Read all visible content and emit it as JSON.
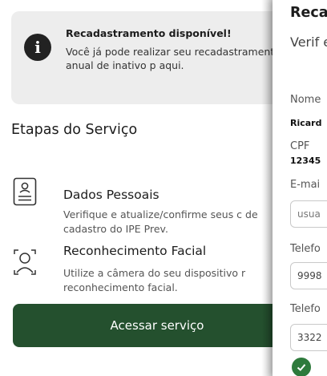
{
  "notice": {
    "title": "Recadastramento disponível!",
    "body": "Você já pode realizar seu recadastramento anual de inativo p aqui."
  },
  "steps_section": {
    "title": "Etapas do Serviço",
    "steps": [
      {
        "title": "Dados Pessoais",
        "description": "Verifique e atualize/confirme seus c de cadastro do IPE Prev.",
        "icon": "id-card-icon"
      },
      {
        "title": "Reconhecimento Facial",
        "description": "Utilize a câmera do seu dispositivo r reconhecimento facial.",
        "icon": "face-scan-icon"
      }
    ]
  },
  "access_button_label": "Acessar serviço",
  "drawer": {
    "title": "Reca",
    "subtitle": "Verif estão",
    "fields": {
      "name": {
        "label": "Nome",
        "value": "Ricard"
      },
      "cpf": {
        "label": "CPF",
        "value": "12345"
      },
      "email": {
        "label": "E-mai",
        "placeholder": "usua"
      },
      "phone": {
        "label": "Telefo",
        "value": "9998"
      },
      "phone2": {
        "label": "Telefo",
        "value": "3322"
      }
    }
  },
  "colors": {
    "primary": "#24502e",
    "notice_bg": "#ededed",
    "check": "#2e7a3c"
  }
}
